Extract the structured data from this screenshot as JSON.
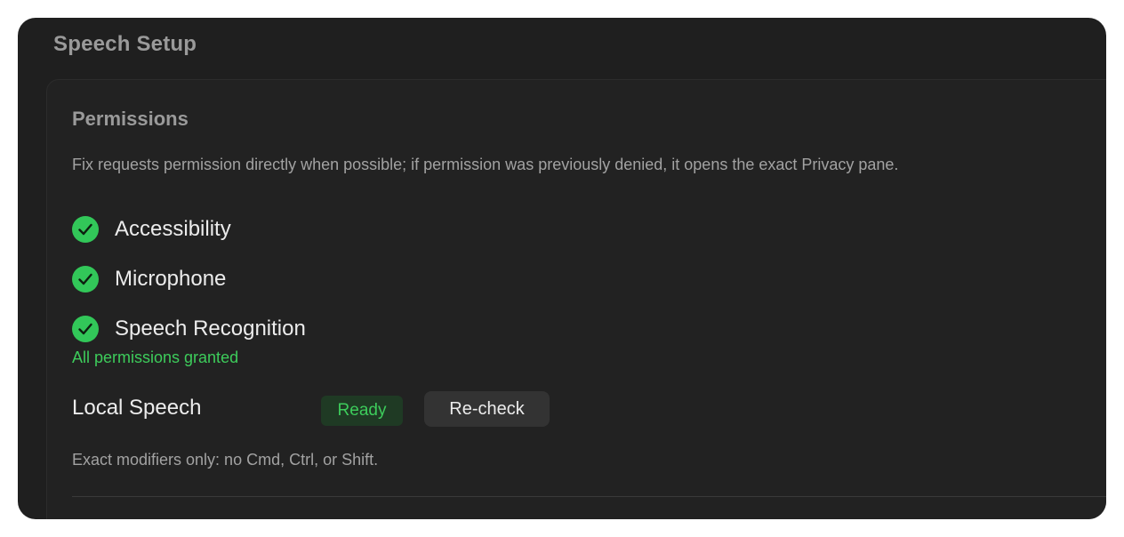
{
  "window": {
    "title": "Speech Setup"
  },
  "permissions": {
    "title": "Permissions",
    "description": "Fix requests permission directly when possible; if permission was previously denied, it opens the exact Privacy pane.",
    "items": [
      {
        "label": "Accessibility",
        "status": "granted",
        "icon": "check-circle-icon"
      },
      {
        "label": "Microphone",
        "status": "granted",
        "icon": "check-circle-icon"
      },
      {
        "label": "Speech Recognition",
        "status": "granted",
        "icon": "check-circle-icon"
      }
    ],
    "summary": "All permissions granted"
  },
  "local_speech": {
    "label": "Local Speech",
    "status_badge": "Ready",
    "recheck_button": "Re-check",
    "footnote": "Exact modifiers only: no Cmd, Ctrl, or Shift."
  },
  "colors": {
    "success_green": "#3dcc5b",
    "window_bg": "#1f1f1f",
    "badge_bg": "#1f3a24",
    "button_bg": "#333333"
  }
}
